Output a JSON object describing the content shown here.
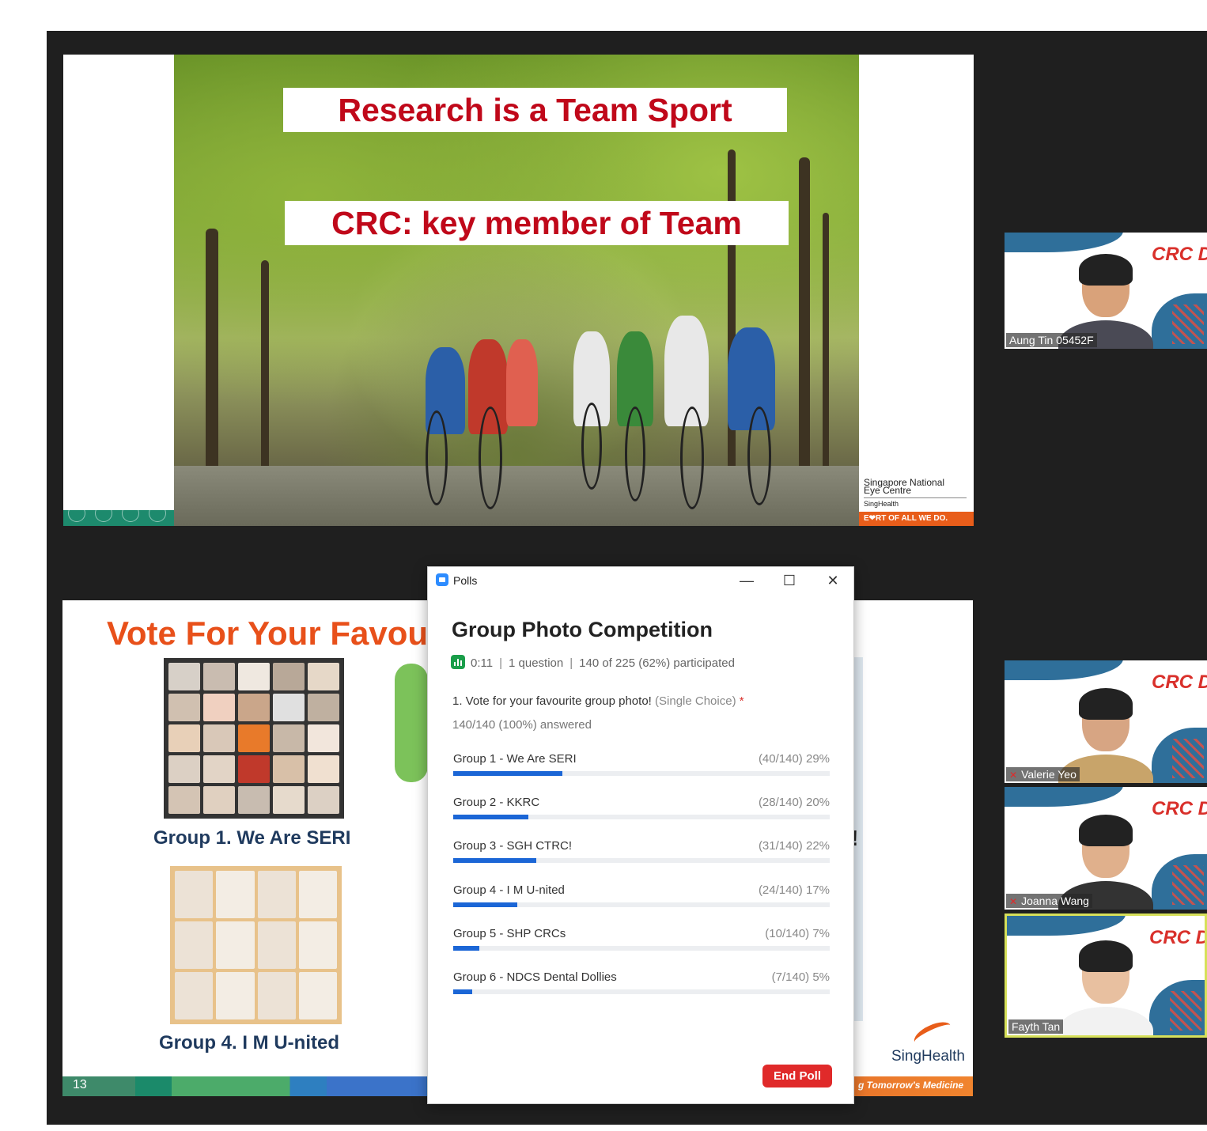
{
  "slide1": {
    "title_line1": "Research is a Team Sport",
    "title_line2": "CRC: key member of Team",
    "logo_line1": "Singapore National",
    "logo_line2": "Eye Centre",
    "logo_line3": "SingHealth",
    "footer_text": "E❤RT OF ALL WE DO."
  },
  "slide2": {
    "heading": "Vote For Your Favou",
    "group1_label": "Group 1. We Are SERI",
    "group4_label": "Group 4. I M U-nited",
    "page_number": "13",
    "logo": "SingHealth",
    "tagline": "g Tomorrow's Medicine",
    "exclaim": "!"
  },
  "polls_window": {
    "title": "Polls",
    "heading": "Group Photo Competition",
    "elapsed": "0:11",
    "question_count": "1 question",
    "participation": "140 of 225 (62%) participated",
    "question": "1. Vote for your favourite group photo!",
    "question_type": "(Single Choice)",
    "required_mark": "*",
    "answered": "140/140 (100%) answered",
    "options": [
      {
        "label": "Group 1 - We Are SERI",
        "result": "(40/140) 29%",
        "percent": 29
      },
      {
        "label": "Group 2 - KKRC",
        "result": "(28/140) 20%",
        "percent": 20
      },
      {
        "label": "Group 3 - SGH CTRC!",
        "result": "(31/140) 22%",
        "percent": 22
      },
      {
        "label": "Group 4 - I M U-nited",
        "result": "(24/140) 17%",
        "percent": 17
      },
      {
        "label": "Group 5 - SHP CRCs",
        "result": "(10/140) 7%",
        "percent": 7
      },
      {
        "label": "Group 6 - NDCS Dental Dollies",
        "result": "(7/140) 5%",
        "percent": 5
      }
    ],
    "end_button": "End Poll",
    "minimize_glyph": "—",
    "maximize_glyph": "☐",
    "close_glyph": "✕"
  },
  "participants": [
    {
      "name": "Aung Tin 05452F",
      "muted": false
    },
    {
      "name": "Valerie Yeo",
      "muted": true
    },
    {
      "name": "Joanna Wang",
      "muted": true
    },
    {
      "name": "Fayth Tan",
      "muted": false,
      "active_speaker": true
    }
  ],
  "background_brand": "CRC D",
  "colors": {
    "accent_blue": "#1b66d6",
    "end_poll_red": "#e02a2a",
    "slide_title_red": "#c0081a",
    "vote_orange": "#e8501a",
    "speaker_highlight": "#d6e05a"
  }
}
